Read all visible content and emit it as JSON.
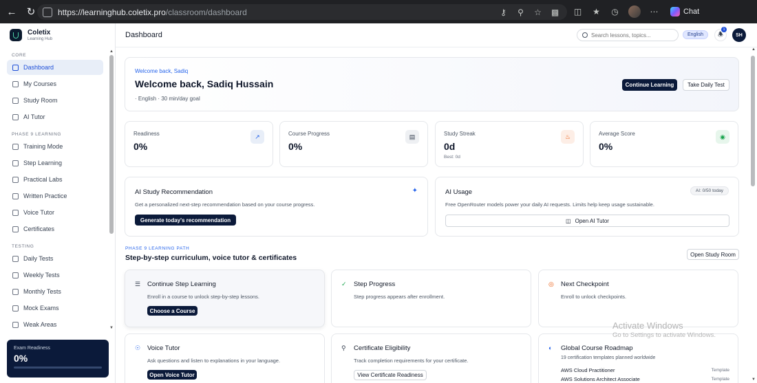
{
  "browser": {
    "url_host": "https://learninghub.coletix.pro",
    "url_path": "/classroom/dashboard",
    "chat_label": "Chat"
  },
  "brand": {
    "name": "Coletix",
    "subtitle": "Learning Hub"
  },
  "sidebar": {
    "sections": [
      {
        "label": "CORE"
      },
      {
        "label": "PHASE 9 LEARNING"
      },
      {
        "label": "TESTING"
      }
    ],
    "items": [
      {
        "label": "Dashboard",
        "icon": "grid-icon"
      },
      {
        "label": "My Courses",
        "icon": "book-icon"
      },
      {
        "label": "Study Room",
        "icon": "graduation-cap-icon"
      },
      {
        "label": "AI Tutor",
        "icon": "bot-icon"
      },
      {
        "label": "Training Mode",
        "icon": "sparkle-icon"
      },
      {
        "label": "Step Learning",
        "icon": "list-icon"
      },
      {
        "label": "Practical Labs",
        "icon": "flask-icon"
      },
      {
        "label": "Written Practice",
        "icon": "pencil-icon"
      },
      {
        "label": "Voice Tutor",
        "icon": "mic-icon"
      },
      {
        "label": "Certificates",
        "icon": "award-icon"
      },
      {
        "label": "Daily Tests",
        "icon": "calendar-icon"
      },
      {
        "label": "Weekly Tests",
        "icon": "calendar-icon"
      },
      {
        "label": "Monthly Tests",
        "icon": "calendar-icon"
      },
      {
        "label": "Mock Exams",
        "icon": "clipboard-icon"
      },
      {
        "label": "Weak Areas",
        "icon": "target-icon"
      }
    ],
    "readiness": {
      "label": "Exam Readiness",
      "value": "0%",
      "progress": 0
    }
  },
  "header": {
    "title": "Dashboard",
    "search_placeholder": "Search lessons, topics...",
    "language": "English",
    "notifications": "1",
    "user_initials": "SH"
  },
  "hero": {
    "kicker": "Welcome back, Sadiq",
    "title": "Welcome back, Sadiq Hussain",
    "meta": "·  English  ·  30 min/day goal",
    "continue_label": "Continue Learning",
    "daily_test_label": "Take Daily Test"
  },
  "stats": [
    {
      "label": "Readiness",
      "value": "0%",
      "sub": "",
      "icon": "trend-up-icon",
      "icon_color": "#2563eb",
      "icon_bg": "#e8eef8"
    },
    {
      "label": "Course Progress",
      "value": "0%",
      "sub": "",
      "icon": "book-open-icon",
      "icon_color": "#374151",
      "icon_bg": "#eef0f3"
    },
    {
      "label": "Study Streak",
      "value": "0d",
      "sub": "Best: 0d",
      "icon": "flame-icon",
      "icon_color": "#ea580c",
      "icon_bg": "#fdeee6"
    },
    {
      "label": "Average Score",
      "value": "0%",
      "sub": "",
      "icon": "medal-icon",
      "icon_color": "#16a34a",
      "icon_bg": "#e7f6ec"
    }
  ],
  "recommendation": {
    "title": "AI Study Recommendation",
    "desc": "Get a personalized next-step recommendation based on your course progress.",
    "button": "Generate today's recommendation"
  },
  "usage": {
    "title": "AI Usage",
    "badge": "AI: 0/50 today",
    "desc": "Free OpenRouter models power your daily AI requests. Limits help keep usage sustainable.",
    "button": "Open AI Tutor"
  },
  "path": {
    "kicker": "PHASE 9 LEARNING PATH",
    "title": "Step-by-step curriculum, voice tutor & certificates",
    "open_button": "Open Study Room",
    "tiles": [
      {
        "title": "Continue Step Learning",
        "desc": "Enroll in a course to unlock step-by-step lessons.",
        "button": "Choose a Course",
        "icon": "list-icon"
      },
      {
        "title": "Step Progress",
        "desc": "Step progress appears after enrollment.",
        "button": "",
        "icon": "check-circle-icon"
      },
      {
        "title": "Next Checkpoint",
        "desc": "Enroll to unlock checkpoints.",
        "button": "",
        "icon": "target-icon"
      },
      {
        "title": "Voice Tutor",
        "desc": "Ask questions and listen to explanations in your language.",
        "button": "Open Voice Tutor",
        "icon": "mic-icon"
      },
      {
        "title": "Certificate Eligibility",
        "desc": "Track completion requirements for your certificate.",
        "button": "View Certificate Readiness",
        "icon": "award-icon"
      },
      {
        "title": "Global Course Roadmap",
        "desc": "19 certification templates planned worldwide",
        "button": "",
        "icon": "globe-icon"
      }
    ],
    "roadmap": [
      {
        "name": "AWS Cloud Practitioner",
        "tag": "Template"
      },
      {
        "name": "AWS Solutions Architect Associate",
        "tag": "Template"
      }
    ]
  },
  "watermark": {
    "line1": "Activate Windows",
    "line2": "Go to Settings to activate Windows."
  }
}
